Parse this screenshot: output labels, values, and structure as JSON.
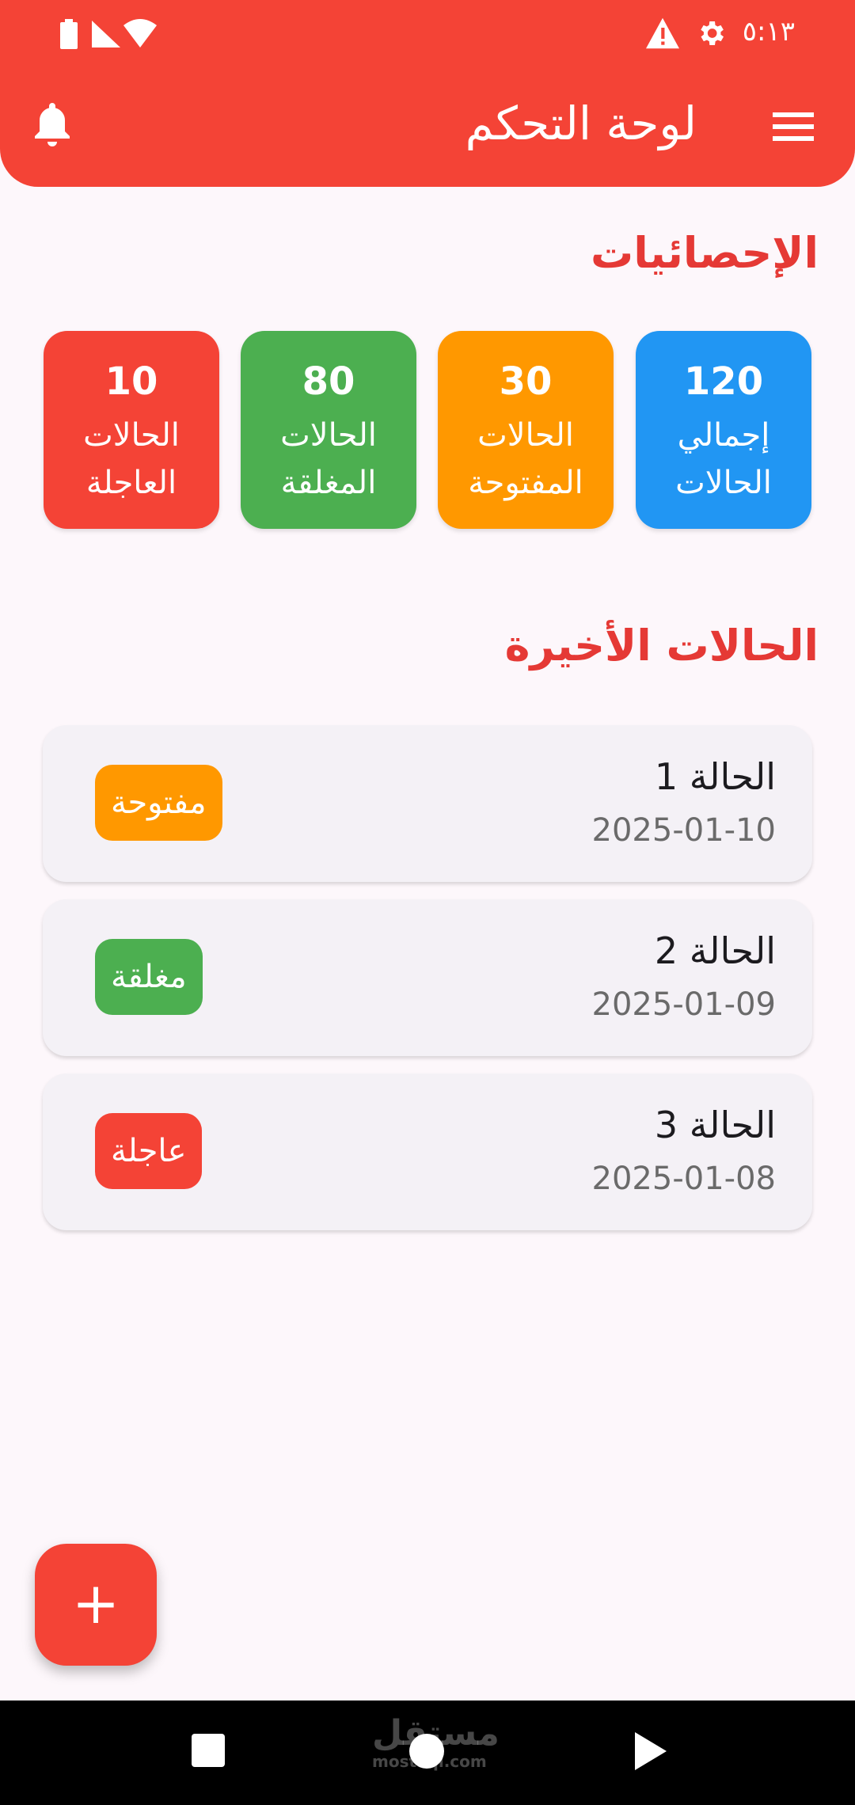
{
  "status_bar": {
    "time": "٥:١٣",
    "icons": [
      "settings-icon",
      "alert-icon",
      "battery-icon",
      "signal-icon",
      "wifi-icon"
    ]
  },
  "header": {
    "title": "لوحة التحكم",
    "menu_icon": "menu-icon",
    "notifications_icon": "bell-icon"
  },
  "stats": {
    "title": "الإحصائيات",
    "cards": [
      {
        "value": "120",
        "label": "إجمالي الحالات",
        "color": "#2196f3"
      },
      {
        "value": "30",
        "label": "الحالات المفتوحة",
        "color": "#ff9800"
      },
      {
        "value": "80",
        "label": "الحالات المغلقة",
        "color": "#4caf50"
      },
      {
        "value": "10",
        "label": "الحالات العاجلة",
        "color": "#f44336"
      }
    ]
  },
  "recent": {
    "title": "الحالات الأخيرة",
    "cases": [
      {
        "title": "الحالة 1",
        "date": "2025-01-10",
        "status": "مفتوحة",
        "status_color": "#ff9800"
      },
      {
        "title": "الحالة 2",
        "date": "2025-01-09",
        "status": "مغلقة",
        "status_color": "#4caf50"
      },
      {
        "title": "الحالة 3",
        "date": "2025-01-08",
        "status": "عاجلة",
        "status_color": "#f44336"
      }
    ]
  },
  "fab": {
    "label": "+",
    "icon": "plus-icon"
  },
  "nav_bar": {
    "icons": [
      "recent-apps-icon",
      "home-icon",
      "back-icon"
    ]
  },
  "watermark": {
    "arabic": "مستقل",
    "latin": "mostaql.com"
  },
  "colors": {
    "primary": "#f44336",
    "background": "#fdf7fb",
    "card": "#f4f1f6"
  }
}
